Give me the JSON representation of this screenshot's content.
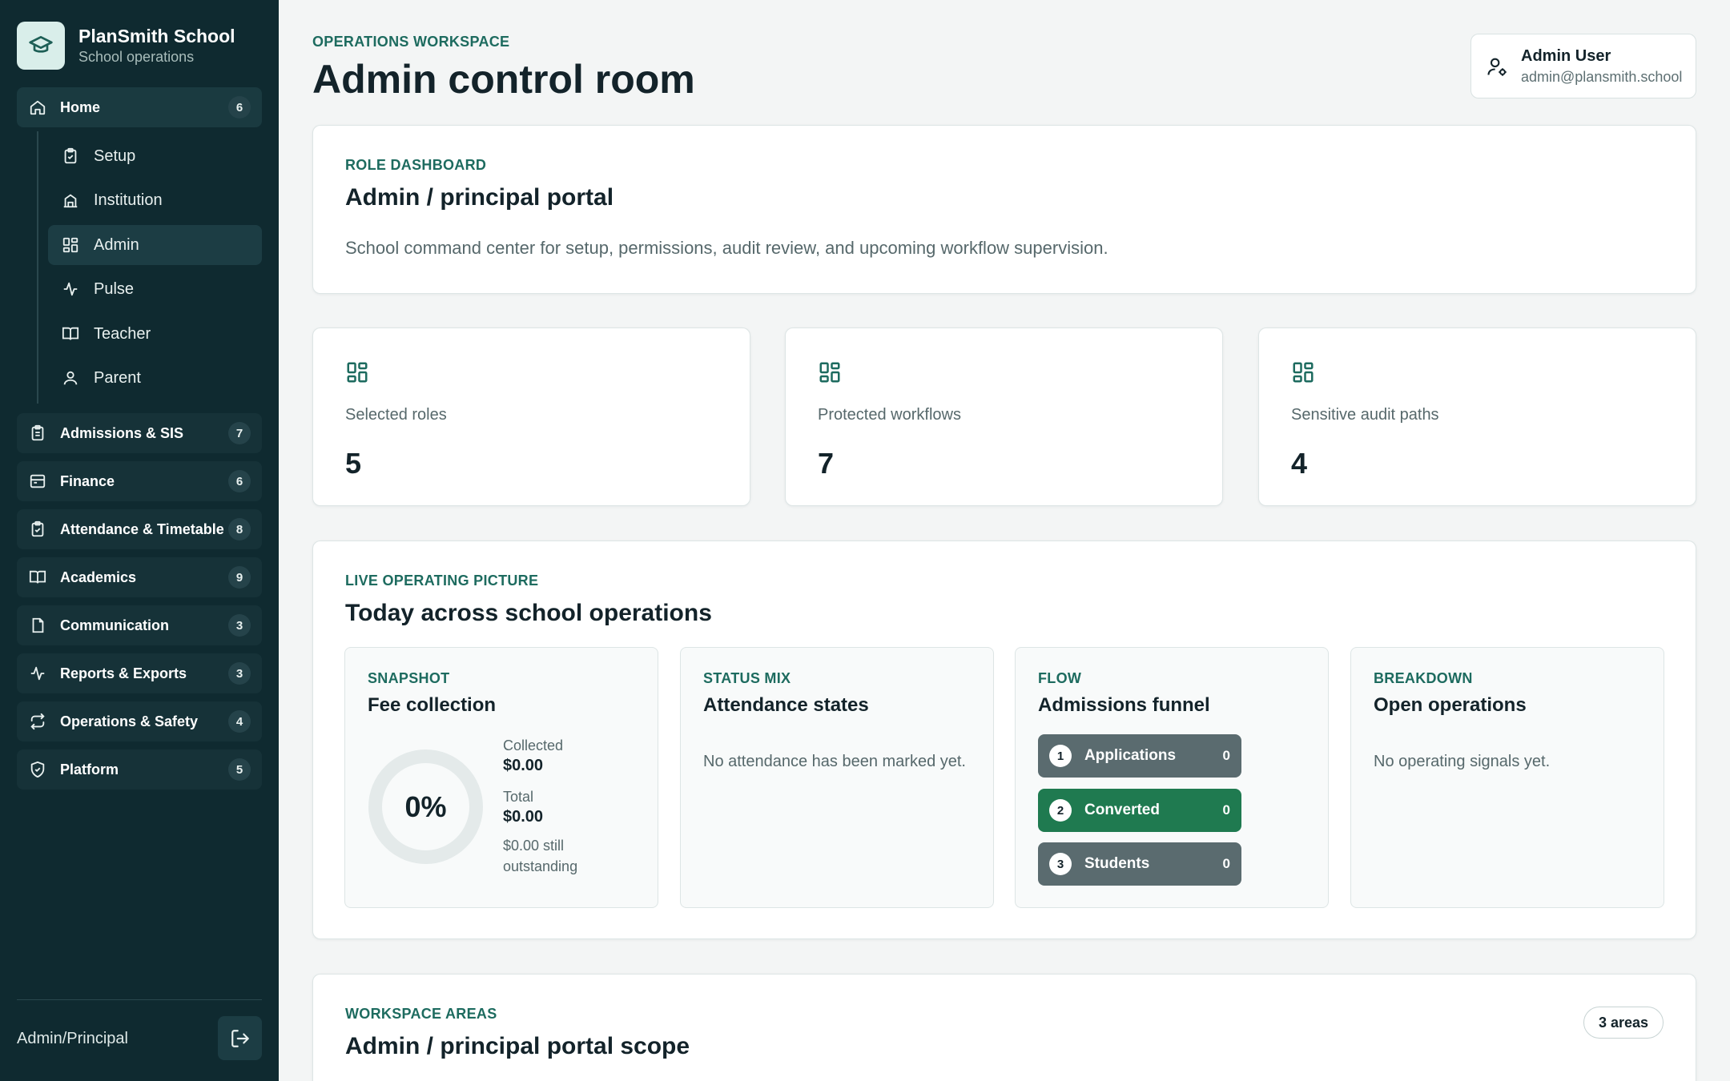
{
  "brand": {
    "name": "PlanSmith School",
    "subtitle": "School operations",
    "logo_icon": "graduation-cap-icon"
  },
  "sidebar": {
    "home": {
      "label": "Home",
      "count": "6",
      "icon": "home-icon"
    },
    "sub_items": [
      {
        "label": "Setup",
        "icon": "clipboard-icon"
      },
      {
        "label": "Institution",
        "icon": "building-icon"
      },
      {
        "label": "Admin",
        "icon": "grid-icon",
        "active": true
      },
      {
        "label": "Pulse",
        "icon": "activity-icon"
      },
      {
        "label": "Teacher",
        "icon": "book-icon"
      },
      {
        "label": "Parent",
        "icon": "user-icon"
      }
    ],
    "groups": [
      {
        "label": "Admissions & SIS",
        "count": "7",
        "icon": "clipboard-icon"
      },
      {
        "label": "Finance",
        "count": "6",
        "icon": "inbox-icon"
      },
      {
        "label": "Attendance & Timetable",
        "count": "8",
        "icon": "clipboard-check-icon"
      },
      {
        "label": "Academics",
        "count": "9",
        "icon": "book-icon"
      },
      {
        "label": "Communication",
        "count": "3",
        "icon": "file-icon"
      },
      {
        "label": "Reports & Exports",
        "count": "3",
        "icon": "activity-icon"
      },
      {
        "label": "Operations & Safety",
        "count": "4",
        "icon": "repeat-icon"
      },
      {
        "label": "Platform",
        "count": "5",
        "icon": "shield-icon"
      }
    ],
    "role": "Admin/Principal"
  },
  "header": {
    "eyebrow": "OPERATIONS WORKSPACE",
    "title": "Admin control room",
    "user_name": "Admin User",
    "user_email": "admin@plansmith.school"
  },
  "role_card": {
    "eyebrow": "ROLE DASHBOARD",
    "title": "Admin / principal portal",
    "description": "School command center for setup, permissions, audit review, and upcoming workflow supervision."
  },
  "metrics": [
    {
      "label": "Selected roles",
      "value": "5"
    },
    {
      "label": "Protected workflows",
      "value": "7"
    },
    {
      "label": "Sensitive audit paths",
      "value": "4"
    }
  ],
  "live": {
    "eyebrow": "LIVE OPERATING PICTURE",
    "title": "Today across school operations",
    "fee": {
      "eyebrow": "SNAPSHOT",
      "title": "Fee collection",
      "percent": "0%",
      "fraction": 0,
      "collected_label": "Collected",
      "collected_value": "$0.00",
      "total_label": "Total",
      "total_value": "$0.00",
      "outstanding": "$0.00 still outstanding"
    },
    "attendance": {
      "eyebrow": "STATUS MIX",
      "title": "Attendance states",
      "empty": "No attendance has been marked yet."
    },
    "funnel": {
      "eyebrow": "FLOW",
      "title": "Admissions funnel",
      "steps": [
        {
          "num": "1",
          "label": "Applications",
          "count": "0"
        },
        {
          "num": "2",
          "label": "Converted",
          "count": "0"
        },
        {
          "num": "3",
          "label": "Students",
          "count": "0"
        }
      ]
    },
    "breakdown": {
      "eyebrow": "BREAKDOWN",
      "title": "Open operations",
      "empty": "No operating signals yet."
    }
  },
  "workspace": {
    "eyebrow": "WORKSPACE AREAS",
    "title": "Admin / principal portal scope",
    "pill": "3 areas"
  },
  "colors": {
    "sidebar_bg": "#0f2a30",
    "accent": "#1d6b5f",
    "converted": "#1f7a50",
    "funnel_step": "#5a6b6f"
  }
}
